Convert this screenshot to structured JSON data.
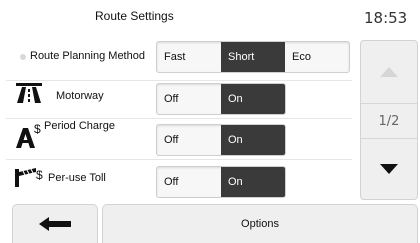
{
  "header": {
    "title": "Route Settings",
    "clock": "18:53"
  },
  "settings": [
    {
      "label": "Route Planning Method",
      "options": [
        "Fast",
        "Short",
        "Eco"
      ],
      "selected": "Short"
    },
    {
      "label": "Motorway",
      "options": [
        "Off",
        "On"
      ],
      "selected": "On"
    },
    {
      "label": "Period Charge",
      "options": [
        "Off",
        "On"
      ],
      "selected": "On"
    },
    {
      "label": "Per-use Toll",
      "options": [
        "Off",
        "On"
      ],
      "selected": "On"
    }
  ],
  "pager": {
    "indicator": "1/2"
  },
  "footer": {
    "options_label": "Options"
  },
  "icons": {
    "motorway": "motorway-icon",
    "period_charge": "period-charge-icon",
    "toll": "toll-icon",
    "up": "chevron-up-icon",
    "down": "chevron-down-icon",
    "back": "arrow-left-icon"
  },
  "colors": {
    "selected_bg": "#3a3a3a",
    "button_bg": "#efefef"
  }
}
